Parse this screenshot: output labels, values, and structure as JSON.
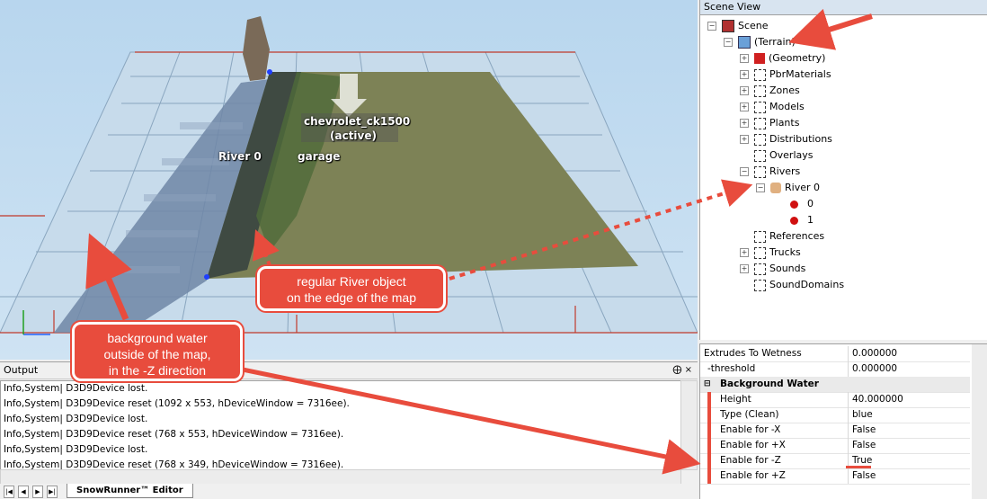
{
  "viewport": {
    "labels": {
      "vehicle": "chevrolet_ck1500",
      "vehicle_state": "(active)",
      "river": "River 0",
      "garage": "garage"
    }
  },
  "output": {
    "title": "Output",
    "pin": "⨁ ×",
    "lines": [
      "Info,System| D3D9Device lost.",
      "Info,System| D3D9Device reset (1092 x 553, hDeviceWindow = 7316ee).",
      "Info,System| D3D9Device lost.",
      "Info,System| D3D9Device reset (768 x 553, hDeviceWindow = 7316ee).",
      "Info,System| D3D9Device lost.",
      "Info,System| D3D9Device reset (768 x 349, hDeviceWindow = 7316ee)."
    ],
    "tab": "SnowRunner™ Editor",
    "nav": [
      "|◀",
      "◀",
      "▶",
      "▶|"
    ]
  },
  "scene_view": {
    "title": "Scene View",
    "tree": {
      "scene": "Scene",
      "terrain": "(Terrain)",
      "geometry": "(Geometry)",
      "pbr": "PbrMaterials",
      "zones": "Zones",
      "models": "Models",
      "plants": "Plants",
      "distributions": "Distributions",
      "overlays": "Overlays",
      "rivers": "Rivers",
      "river0": "River 0",
      "p0": "0",
      "p1": "1",
      "references": "References",
      "trucks": "Trucks",
      "sounds": "Sounds",
      "sounddomains": "SoundDomains"
    }
  },
  "properties": {
    "rows": [
      {
        "k": "Extrudes To Wetness",
        "v": "0.000000"
      },
      {
        "k": "-threshold",
        "v": "0.000000"
      }
    ],
    "group": "Background Water",
    "water": [
      {
        "k": "Height",
        "v": "40.000000"
      },
      {
        "k": "Type (Clean)",
        "v": "blue"
      },
      {
        "k": "Enable for -X",
        "v": "False"
      },
      {
        "k": "Enable for +X",
        "v": "False"
      },
      {
        "k": "Enable for -Z",
        "v": "True"
      },
      {
        "k": "Enable for +Z",
        "v": "False"
      }
    ]
  },
  "annotations": {
    "bg_water": "background water outside of the map, in the -Z direction",
    "bg_water_lines": [
      "background water",
      "outside of the map,",
      "in the -Z direction"
    ],
    "river_lines": [
      "regular River object",
      "on the edge of the map"
    ]
  },
  "colors": {
    "accent": "#e84c3d",
    "grid": "#c0392b"
  }
}
